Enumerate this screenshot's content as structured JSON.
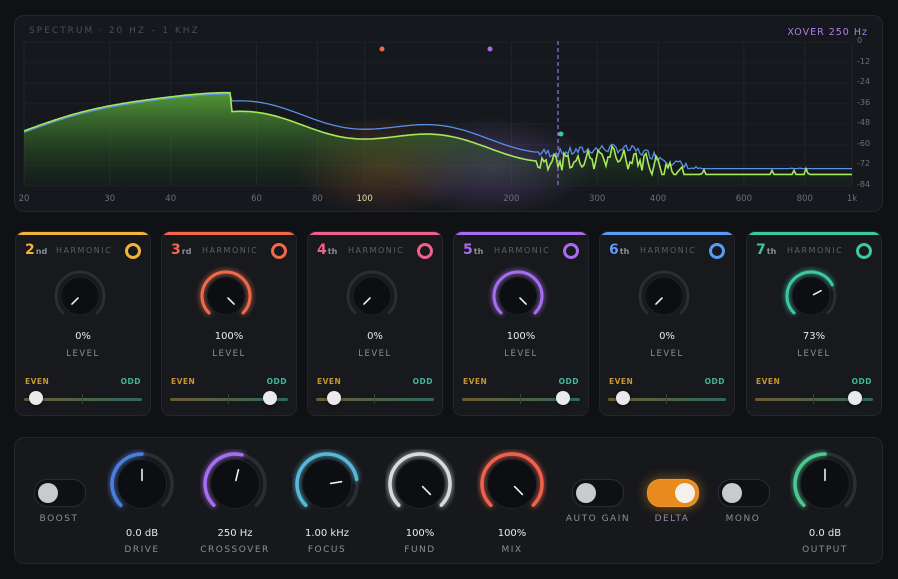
{
  "spectrum": {
    "title": "SPECTRUM · 20 HZ – 1 KHZ",
    "xover_label": "XOVER 250 Hz",
    "x_ticks": [
      {
        "label": "20",
        "hz": 20
      },
      {
        "label": "30",
        "hz": 30
      },
      {
        "label": "40",
        "hz": 40
      },
      {
        "label": "60",
        "hz": 60
      },
      {
        "label": "80",
        "hz": 80
      },
      {
        "label": "100",
        "hz": 100,
        "highlight": true
      },
      {
        "label": "200",
        "hz": 200
      },
      {
        "label": "300",
        "hz": 300
      },
      {
        "label": "400",
        "hz": 400
      },
      {
        "label": "600",
        "hz": 600
      },
      {
        "label": "800",
        "hz": 800
      },
      {
        "label": "1k",
        "hz": 1000
      }
    ],
    "y_ticks": [
      "0",
      "-12",
      "-24",
      "-36",
      "-48",
      "-60",
      "-72",
      "-84"
    ],
    "colors": {
      "input": "#5b8fe6",
      "output": "#9ee05a",
      "xover": "#9c74e0"
    }
  },
  "harmonics": [
    {
      "number": "2",
      "suffix": "nd",
      "title": "HARMONIC",
      "level": 0,
      "level_text": "0%",
      "level_label": "LEVEL",
      "even": "EVEN",
      "odd": "ODD",
      "balance": 0.1,
      "color": "#f0b43c",
      "active": true
    },
    {
      "number": "3",
      "suffix": "rd",
      "title": "HARMONIC",
      "level": 100,
      "level_text": "100%",
      "level_label": "LEVEL",
      "even": "EVEN",
      "odd": "ODD",
      "balance": 0.85,
      "color": "#f06a4a",
      "active": true
    },
    {
      "number": "4",
      "suffix": "th",
      "title": "HARMONIC",
      "level": 0,
      "level_text": "0%",
      "level_label": "LEVEL",
      "even": "EVEN",
      "odd": "ODD",
      "balance": 0.15,
      "color": "#f0608a",
      "active": true
    },
    {
      "number": "5",
      "suffix": "th",
      "title": "HARMONIC",
      "level": 100,
      "level_text": "100%",
      "level_label": "LEVEL",
      "even": "EVEN",
      "odd": "ODD",
      "balance": 0.86,
      "color": "#a86cf0",
      "active": true
    },
    {
      "number": "6",
      "suffix": "th",
      "title": "HARMONIC",
      "level": 0,
      "level_text": "0%",
      "level_label": "LEVEL",
      "even": "EVEN",
      "odd": "ODD",
      "balance": 0.13,
      "color": "#5a9cf0",
      "active": true
    },
    {
      "number": "7",
      "suffix": "th",
      "title": "HARMONIC",
      "level": 73,
      "level_text": "73%",
      "level_label": "LEVEL",
      "even": "EVEN",
      "odd": "ODD",
      "balance": 0.85,
      "color": "#3cc8a0",
      "active": true
    }
  ],
  "controls": {
    "boost": {
      "label": "BOOST",
      "on": false
    },
    "drive": {
      "value": "0.0 dB",
      "label": "DRIVE",
      "color": "#4a7ee0",
      "fraction": 0.5
    },
    "crossover": {
      "value": "250 Hz",
      "label": "CROSSOVER",
      "color": "#a86cf0",
      "fraction": 0.55
    },
    "focus": {
      "value": "1.00 kHz",
      "label": "FOCUS",
      "color": "#58b8d8",
      "fraction": 0.8
    },
    "fund": {
      "value": "100%",
      "label": "FUND",
      "color": "#d8dade",
      "fraction": 1.0
    },
    "mix": {
      "value": "100%",
      "label": "MIX",
      "color": "#f0604a",
      "fraction": 1.0
    },
    "auto_gain": {
      "label": "AUTO GAIN",
      "on": false
    },
    "delta": {
      "label": "DELTA",
      "on": true
    },
    "mono": {
      "label": "MONO",
      "on": false
    },
    "output": {
      "value": "0.0 dB",
      "label": "OUTPUT",
      "color": "#4cc890",
      "fraction": 0.5
    }
  }
}
